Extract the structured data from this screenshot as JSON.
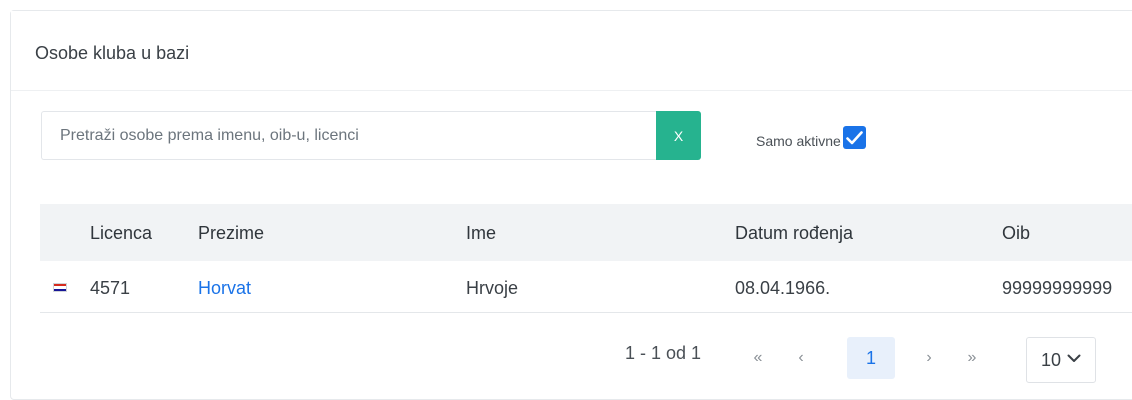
{
  "card": {
    "title": "Osobe kluba u bazi"
  },
  "search": {
    "placeholder": "Pretraži osobe prema imenu, oib-u, licenci",
    "value": "",
    "clear_label": "X"
  },
  "filter": {
    "active_label": "Samo aktivne",
    "active_checked": true
  },
  "table": {
    "columns": [
      "Licenca",
      "Prezime",
      "Ime",
      "Datum rođenja",
      "Oib"
    ],
    "rows": [
      {
        "flag": "croatia-flag-icon",
        "licenca": "4571",
        "prezime": "Horvat",
        "ime": "Hrvoje",
        "datum": "08.04.1966.",
        "oib": "99999999999"
      }
    ]
  },
  "pagination": {
    "info": "1 - 1 od 1",
    "first": "«",
    "prev": "‹",
    "current_page": "1",
    "next": "›",
    "last": "»",
    "page_size": "10"
  },
  "colors": {
    "accent": "#1a73e8",
    "clear_button": "#26b38f",
    "header_bg": "#f1f3f5"
  }
}
